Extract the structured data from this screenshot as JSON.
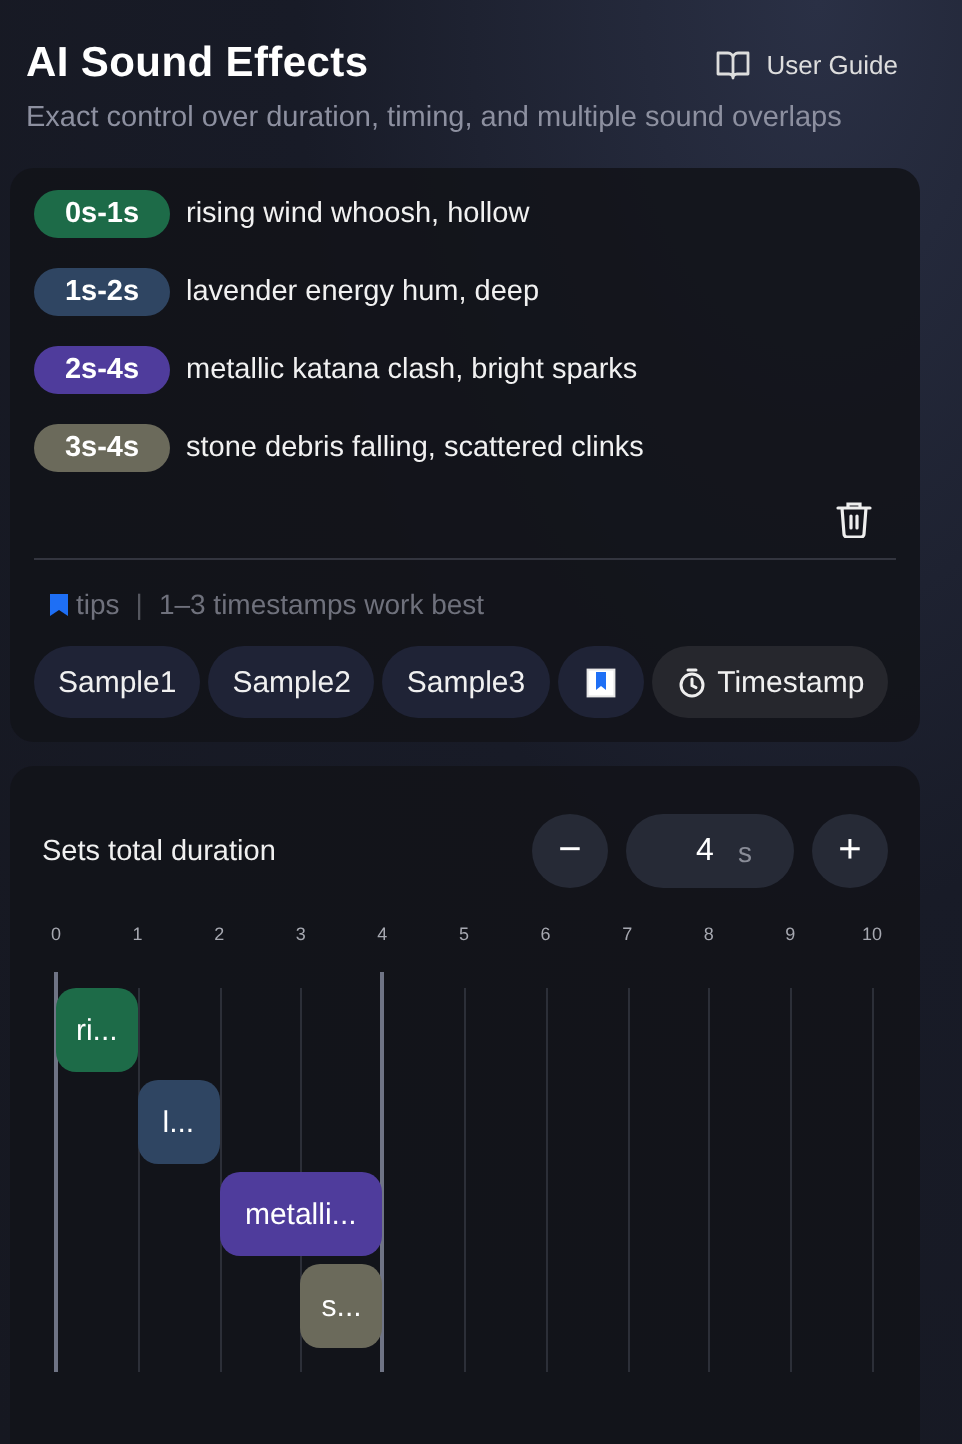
{
  "header": {
    "title": "AI Sound Effects",
    "guide_link": "User Guide",
    "subtitle": "Exact control over duration, timing, and multiple sound overlaps"
  },
  "segments": [
    {
      "time": "0s-1s",
      "text": "rising wind whoosh, hollow",
      "color": "#1d6b48",
      "block_label": "ri..."
    },
    {
      "time": "1s-2s",
      "text": "lavender energy hum, deep",
      "color": "#2f4562",
      "block_label": "l..."
    },
    {
      "time": "2s-4s",
      "text": "metallic katana clash, bright sparks",
      "color": "#4f3c9c",
      "block_label": "metalli..."
    },
    {
      "time": "3s-4s",
      "text": "stone debris falling, scattered clinks",
      "color": "#6b6a5b",
      "block_label": "s..."
    }
  ],
  "tips": {
    "label": "tips",
    "separator": "|",
    "text": "1–3 timestamps work best"
  },
  "samples": [
    "Sample1",
    "Sample2",
    "Sample3"
  ],
  "timestamp_button": "Timestamp",
  "duration": {
    "label": "Sets total duration",
    "minus": "−",
    "value": "4",
    "unit": "s",
    "plus": "+"
  },
  "ticks": [
    "0",
    "1",
    "2",
    "3",
    "4",
    "5",
    "6",
    "7",
    "8",
    "9",
    "10"
  ]
}
